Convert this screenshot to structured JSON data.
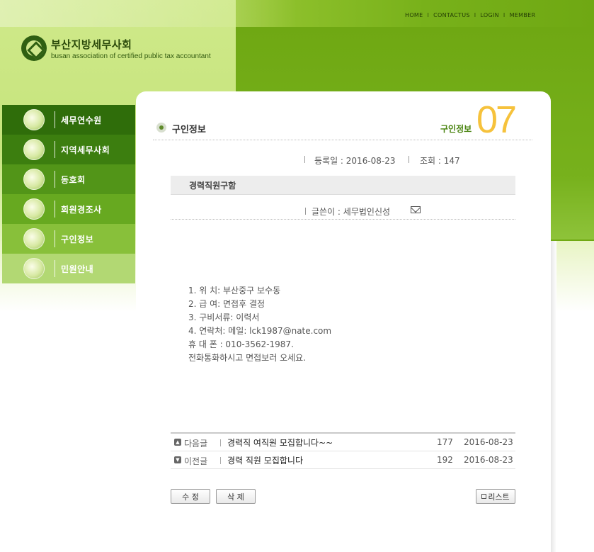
{
  "topnav": {
    "home": "HOME",
    "contact": "CONTACTUS",
    "login": "LOGIN",
    "member": "MEMBER",
    "sep": "I"
  },
  "logo": {
    "korean": "부산지방세무사회",
    "english": "busan association of certified public tax accountant"
  },
  "sidebar": {
    "items": [
      {
        "label": "세무연수원"
      },
      {
        "label": "지역세무사회"
      },
      {
        "label": "동호회"
      },
      {
        "label": "회원경조사"
      },
      {
        "label": "구인정보"
      },
      {
        "label": "민원안내"
      }
    ]
  },
  "page": {
    "title": "구인정보",
    "crumb": "구인정보",
    "number": "07"
  },
  "post": {
    "date_label": "등록일 : 2016-08-23",
    "views_label": "조회 : 147",
    "subject": "경력직원구함",
    "writer_label": "글쓴이 : 세무법인신성",
    "body": [
      "1. 위 치: 부산중구 보수동",
      "2. 급 여: 면접후 결정",
      "3. 구비서류: 이력서",
      "4. 연락처: 메일: lck1987@nate.com",
      "휴 대 폰 : 010-3562-1987.",
      "전화통화하시고 면접보러 오세요."
    ]
  },
  "navigation": [
    {
      "kind": "다음글",
      "title": "경력직 여직원 모집합니다~~",
      "count": "177",
      "date": "2016-08-23"
    },
    {
      "kind": "이전글",
      "title": "경력 직원 모집합니다",
      "count": "192",
      "date": "2016-08-23"
    }
  ],
  "buttons": {
    "edit": "수 정",
    "delete": "삭 제",
    "list": "리스트"
  },
  "colors": {
    "accent": "#6fa813",
    "number": "#f6c23c",
    "sidebar_active": "#88c03a"
  }
}
